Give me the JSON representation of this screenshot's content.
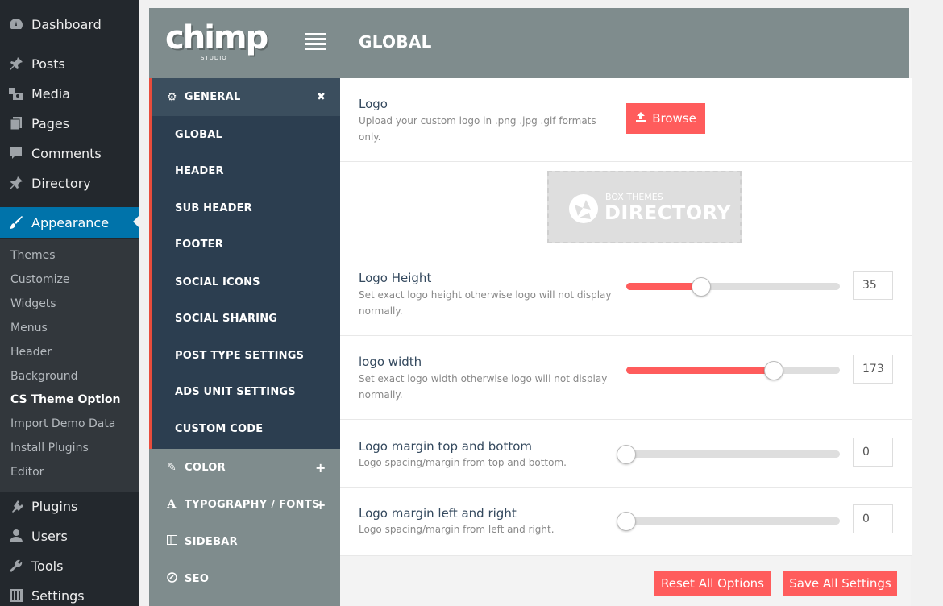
{
  "wp_menu": {
    "items": [
      {
        "label": "Dashboard",
        "icon": "dashboard-icon"
      },
      {
        "label": "Posts",
        "icon": "pin-icon"
      },
      {
        "label": "Media",
        "icon": "media-icon"
      },
      {
        "label": "Pages",
        "icon": "pages-icon"
      },
      {
        "label": "Comments",
        "icon": "comment-icon"
      },
      {
        "label": "Directory",
        "icon": "pin-icon"
      },
      {
        "label": "Appearance",
        "icon": "paintbrush-icon"
      },
      {
        "label": "Plugins",
        "icon": "plugin-icon"
      },
      {
        "label": "Users",
        "icon": "user-icon"
      },
      {
        "label": "Tools",
        "icon": "wrench-icon"
      },
      {
        "label": "Settings",
        "icon": "settings-icon"
      }
    ],
    "submenu": [
      "Themes",
      "Customize",
      "Widgets",
      "Menus",
      "Header",
      "Background",
      "CS Theme Option",
      "Import Demo Data",
      "Install Plugins",
      "Editor"
    ]
  },
  "header": {
    "logo_text": "chimp",
    "logo_sub": "STUDIO",
    "title": "GLOBAL"
  },
  "nav": {
    "general": {
      "label": "GENERAL",
      "items": [
        "GLOBAL",
        "HEADER",
        "SUB HEADER",
        "FOOTER",
        "SOCIAL ICONS",
        "SOCIAL SHARING",
        "POST TYPE SETTINGS",
        "ADS UNIT SETTINGS",
        "CUSTOM CODE"
      ]
    },
    "sections": [
      {
        "label": "COLOR",
        "icon": "magic-wand-icon"
      },
      {
        "label": "TYPOGRAPHY / FONTS",
        "icon": "font-icon"
      },
      {
        "label": "SIDEBAR",
        "icon": "columns-icon"
      },
      {
        "label": "SEO",
        "icon": "seo-icon"
      }
    ]
  },
  "logo": {
    "title": "Logo",
    "desc": "Upload your custom logo in .png .jpg .gif formats only.",
    "browse_label": "Browse",
    "preview_small": "BOX THEMES",
    "preview_big": "DIRECTORY"
  },
  "logo_height": {
    "title": "Logo Height",
    "desc": "Set exact logo height otherwise logo will not display normally.",
    "value": "35",
    "level": 0.35
  },
  "logo_width": {
    "title": "logo width",
    "desc": "Set exact logo width otherwise logo will not display normally.",
    "value": "173",
    "level": 0.69
  },
  "margin_tb": {
    "title": "Logo margin top and bottom",
    "desc": "Logo spacing/margin from top and bottom.",
    "value": "0",
    "level": 0
  },
  "margin_lr": {
    "title": "Logo margin left and right",
    "desc": "Logo spacing/margin from left and right.",
    "value": "0",
    "level": 0
  },
  "buttons": {
    "reset": "Reset All Options",
    "save": "Save All Settings"
  },
  "colors": {
    "accent": "#ff5c5c",
    "nav_dark": "#2c3e50",
    "header": "#7f8c8d",
    "wp_blue": "#0073aa"
  }
}
